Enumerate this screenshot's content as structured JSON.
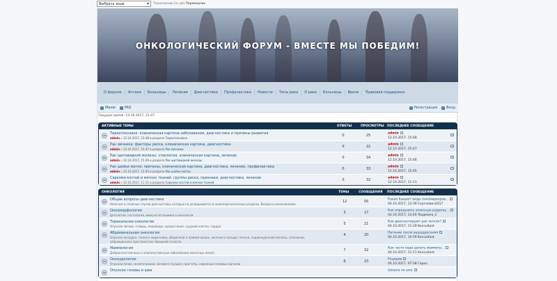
{
  "translate": {
    "select": "Выбрать язык",
    "powered": "Технологии",
    "google": [
      "G",
      "o",
      "o",
      "g",
      "l",
      "e"
    ],
    "translate": "Переводчик"
  },
  "banner": {
    "title": "ОНКОЛОГИЧЕСКИЙ ФОРУМ - ВМЕСТЕ МЫ ПОБЕДИМ!"
  },
  "nav": [
    "О форуме",
    "Аптеки",
    "Больницы",
    "Лечение",
    "Диагностика",
    "Профилактика",
    "Новости",
    "Типы рака",
    "О раке",
    "Больницы",
    "Врачи",
    "Правовая поддержка"
  ],
  "subnav": {
    "menu": "Меню",
    "faq": "FAQ",
    "register": "Регистрация",
    "login": "Вход"
  },
  "current_time": "Текущее время: 14.10.2017, 21:47",
  "active": {
    "headers": {
      "title": "АКТИВНЫЕ ТЕМЫ",
      "replies": "ОТВЕТЫ",
      "views": "ПРОСМОТРЫ",
      "last": "ПОСЛЕДНЕЕ СООБЩЕНИЕ"
    },
    "rows": [
      {
        "title": "Тиреотоксикоз: клиническая картина заболевания, диагностика и причины развития",
        "author": "admin",
        "meta": " » 12.10.2017, 15:48 в разделе ",
        "forum": "Тиреотоксикоз",
        "replies": "0",
        "views": "25",
        "last_user": "admin",
        "last_date": "12.10.2017, 15:48"
      },
      {
        "title": "Рак яичника: факторы риска, клиническая картина, диагностика.",
        "author": "admin",
        "meta": " » 12.10.2017, 15:47 в разделе ",
        "forum": "Рак яичника",
        "replies": "0",
        "views": "22",
        "last_user": "admin",
        "last_date": "12.10.2017, 15:47"
      },
      {
        "title": "Рак щитовидной железы: этиология, клиническая картина, лечение",
        "author": "admin",
        "meta": " » 12.10.2017, 15:46 в разделе ",
        "forum": "Рак щитовидной железы",
        "replies": "0",
        "views": "34",
        "last_user": "admin",
        "last_date": "12.10.2017, 15:46"
      },
      {
        "title": "Рак шейки матки: причины, клиническая картина, диагностика, лечение, профилактика",
        "author": "admin",
        "meta": " » 12.10.2017, 15:45 в разделе ",
        "forum": "Рак шейки матки",
        "replies": "0",
        "views": "33",
        "last_user": "admin",
        "last_date": "12.10.2017, 15:45"
      },
      {
        "title": "Саркома костей и мягких тканей: группы риска, признаки, диагностика, лечение",
        "author": "admin",
        "meta": " » 12.10.2017, 11:11 в разделе ",
        "forum": "Саркома костей и мягких тканей",
        "replies": "0",
        "views": "32",
        "last_user": "admin",
        "last_date": "12.10.2017, 11:11"
      }
    ]
  },
  "oncology": {
    "headers": {
      "title": "ОНКОЛОГИЯ",
      "topics": "ТЕМЫ",
      "posts": "СООБЩЕНИЯ",
      "last": "ПОСЛЕДНЕЕ СООБЩЕНИЕ"
    },
    "rows": [
      {
        "title": "Общие вопросы диагностики",
        "desc": "Неясные и сложные случаи диагностики, которые не укладываются в нижеперечисленные разделы. Вопросы онкоэпинемия.",
        "desc2": "",
        "topics": "12",
        "posts": "56",
        "last_title": "Какие бывают виды онкомаркеров...",
        "last_date": "04.10.2017, 12:39 Сергеевич2017"
      },
      {
        "title": "Онкоморфология",
        "desc": "Цитология, гистология, иммуногистохимия в онкологии",
        "desc2": "",
        "topics": "3",
        "posts": "17",
        "last_title": "Как определить эпоксную родинку...",
        "last_date": "02.10.2017, 13:40 Людмила_С"
      },
      {
        "title": "Торакальная онкология",
        "desc": "Опухоли легких, плевры, пищевода, средостения, грудной клетки, сердца",
        "desc2": "",
        "topics": "5",
        "posts": "21",
        "last_title": "Как диагностируют рак легких?",
        "last_date": "04.10.2017, 11:19 Konsultant"
      },
      {
        "title": "Абдоминальная онкология",
        "desc": "Опухоли желудка, тонкого кишечника, ободочной и прямой кишок, желчного пузыря, печени, поджелудочной железы, селезенки,",
        "desc2": "забрюшинного пространства, брюшной полости",
        "topics": "4",
        "posts": "20",
        "last_title": "Питание после вшуцдросения",
        "last_date": "04.10.2017, 10:59 Konsultant"
      },
      {
        "title": "Маммология",
        "desc": "Доброкачественные и злокачественные заболевания молочных желез",
        "desc2": "",
        "topics": "7",
        "posts": "32",
        "last_title": "Как часто надо делать маммогр...",
        "last_date": "04.10.2017, 11:11 Konsultant"
      },
      {
        "title": "Онкоурология",
        "desc": "Опухоли почек, мочеточников, мочевого пузыря, простаты, наружных половых органов",
        "desc2": "",
        "topics": "6",
        "posts": "23",
        "last_title": "Рецидив",
        "last_date": "04.10.2017, 07:38 Герко"
      },
      {
        "title": "Опухоли головы и шеи",
        "desc": "",
        "desc2": "",
        "topics": "",
        "posts": "",
        "last_title": "Шишка на шее",
        "last_date": ""
      }
    ]
  }
}
